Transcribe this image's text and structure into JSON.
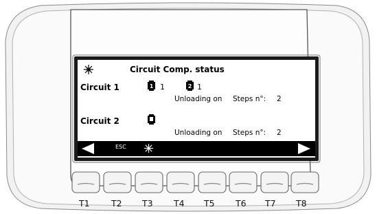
{
  "screen": {
    "title": "Circuit Comp. status",
    "circuits": [
      {
        "label": "Circuit 1",
        "compressors": [
          "1",
          "1"
        ],
        "status": "Unloading on",
        "steps_label": "Steps n°:",
        "steps_value": "2"
      },
      {
        "label": "Circuit 2",
        "compressors": [],
        "status": "Unloading on",
        "steps_label": "Steps n°:",
        "steps_value": "2"
      }
    ],
    "footer": {
      "esc_label": "ESC"
    }
  },
  "buttons": [
    "T1",
    "T2",
    "T3",
    "T4",
    "T5",
    "T6",
    "T7",
    "T8"
  ]
}
